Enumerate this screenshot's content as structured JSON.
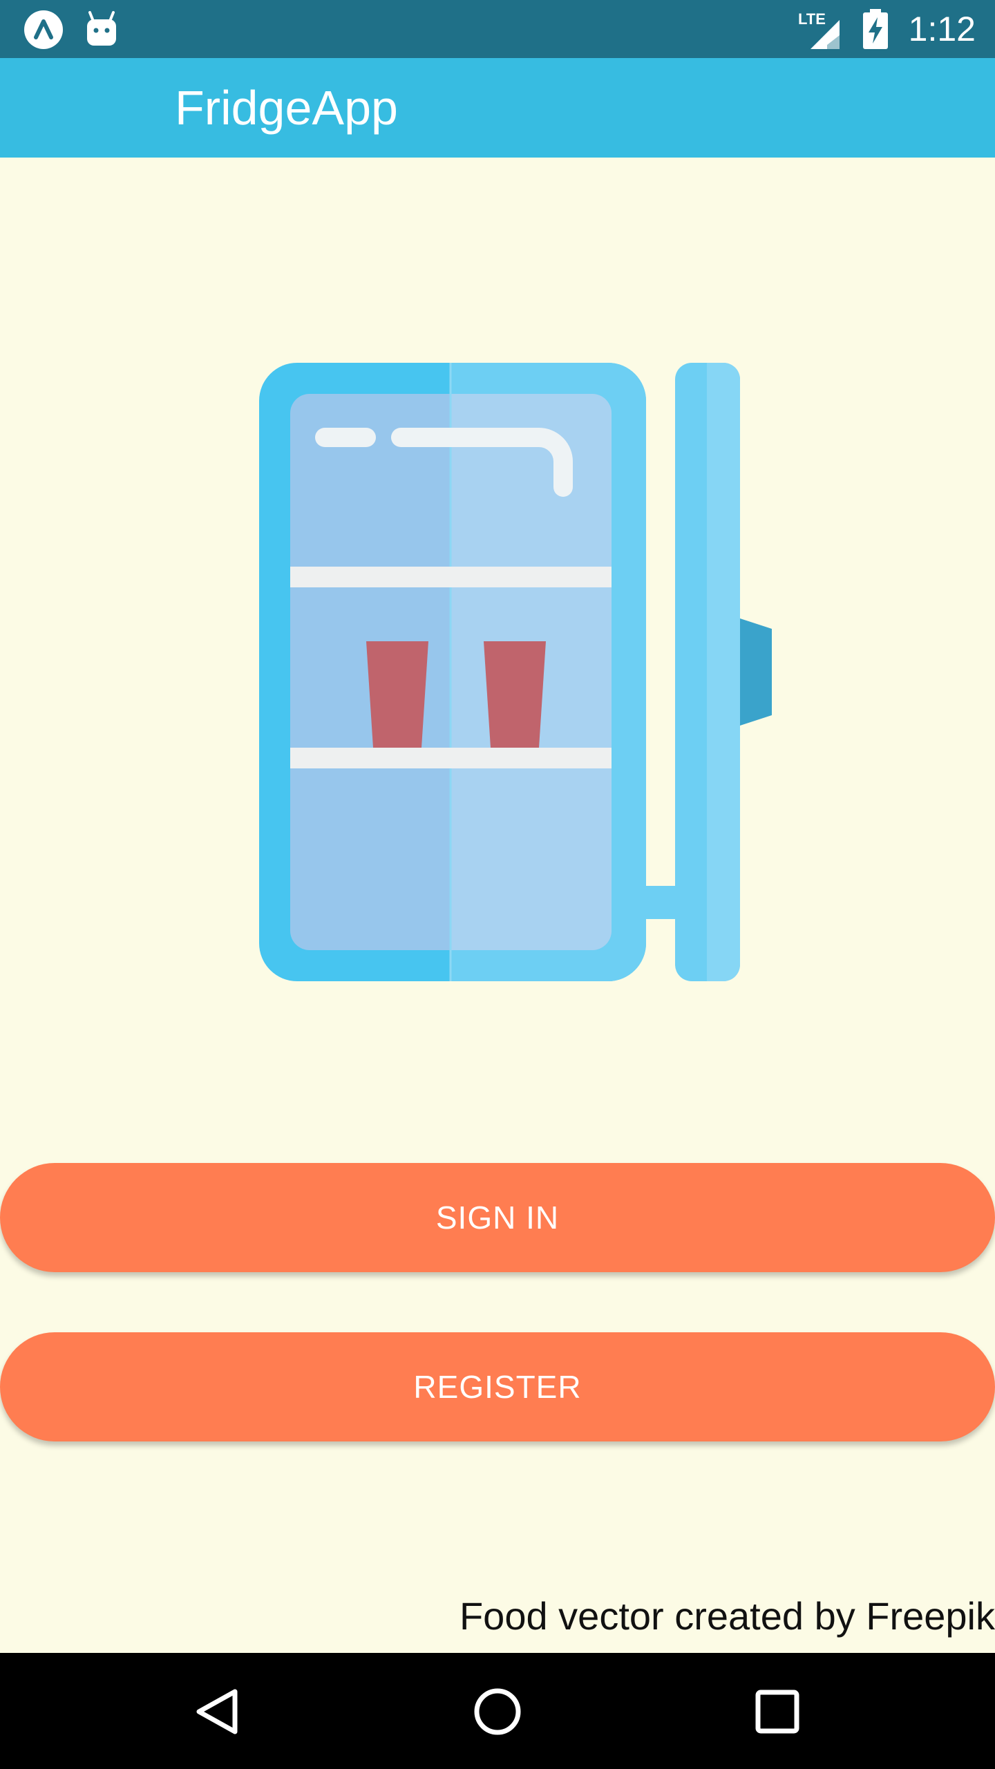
{
  "status_bar": {
    "left_icons": [
      "app-launcher-icon",
      "android-icon"
    ],
    "network_label": "LTE",
    "time": "1:12",
    "background": "#1F7088"
  },
  "app_bar": {
    "title": "FridgeApp",
    "background": "#37BCE1"
  },
  "illustration": {
    "name": "open-fridge-illustration"
  },
  "actions": {
    "sign_in_label": "SIGN IN",
    "register_label": "REGISTER",
    "button_color": "#FF7D51"
  },
  "footer": {
    "attribution": "Food vector created by Freepik"
  },
  "nav_bar": {
    "buttons": [
      "back-icon",
      "home-icon",
      "recents-icon"
    ]
  },
  "colors": {
    "page_background": "#FCFBE5",
    "accent": "#37BCE1"
  }
}
